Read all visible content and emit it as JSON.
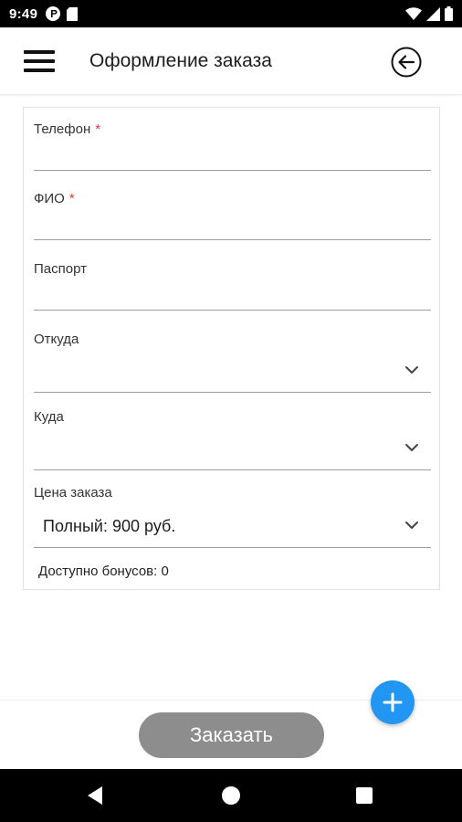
{
  "status_bar": {
    "time": "9:49",
    "icons": [
      "app-notification-icon",
      "sim-card-icon",
      "wifi-icon",
      "signal-icon",
      "battery-icon"
    ]
  },
  "app_bar": {
    "title": "Оформление заказа",
    "menu_icon": "hamburger-menu-icon",
    "back_icon": "circle-arrow-left-icon"
  },
  "form": {
    "phone": {
      "label": "Телефон",
      "required_mark": "*",
      "value": ""
    },
    "fio": {
      "label": "ФИО",
      "required_mark": "*",
      "value": ""
    },
    "passport": {
      "label": "Паспорт",
      "value": ""
    },
    "from": {
      "label": "Откуда",
      "value": ""
    },
    "to": {
      "label": "Куда",
      "value": ""
    },
    "price": {
      "label": "Цена заказа",
      "value": "Полный: 900 руб."
    },
    "bonus_text": "Доступно бонусов: 0"
  },
  "actions": {
    "order_label": "Заказать",
    "fab_icon": "plus-icon"
  },
  "colors": {
    "accent": "#2196f3",
    "required": "#e53935",
    "order_button": "#8d8d8d"
  }
}
